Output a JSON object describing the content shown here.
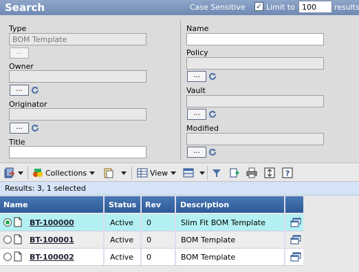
{
  "header": {
    "title": "Search",
    "case_sensitive": "Case Sensitive",
    "limit_label": "Limit to",
    "limit_value": "100",
    "results_suffix": "results"
  },
  "form": {
    "type_label": "Type",
    "type_value": "BOM Template",
    "owner_label": "Owner",
    "originator_label": "Originator",
    "title_label": "Title",
    "name_label": "Name",
    "policy_label": "Policy",
    "vault_label": "Vault",
    "modified_label": "Modified",
    "browse_label": "..."
  },
  "toolbar": {
    "collections_label": "Collections",
    "view_label": "View"
  },
  "results_bar": "Results: 3, 1 selected",
  "table": {
    "headers": [
      "Name",
      "Status",
      "Rev",
      "Description"
    ],
    "rows": [
      {
        "name": "BT-100000",
        "status": "Active",
        "rev": "0",
        "description": "Slim Fit BOM Template"
      },
      {
        "name": "BT-100001",
        "status": "Active",
        "rev": "0",
        "description": "BOM Template"
      },
      {
        "name": "BT-100002",
        "status": "Active",
        "rev": "0",
        "description": "BOM Template"
      }
    ]
  },
  "colors": {
    "header_bg": "#7a93bb",
    "form_bg": "#dcdcdc",
    "table_header": "#3b69a8",
    "selected_row": "#b3f0f2"
  }
}
